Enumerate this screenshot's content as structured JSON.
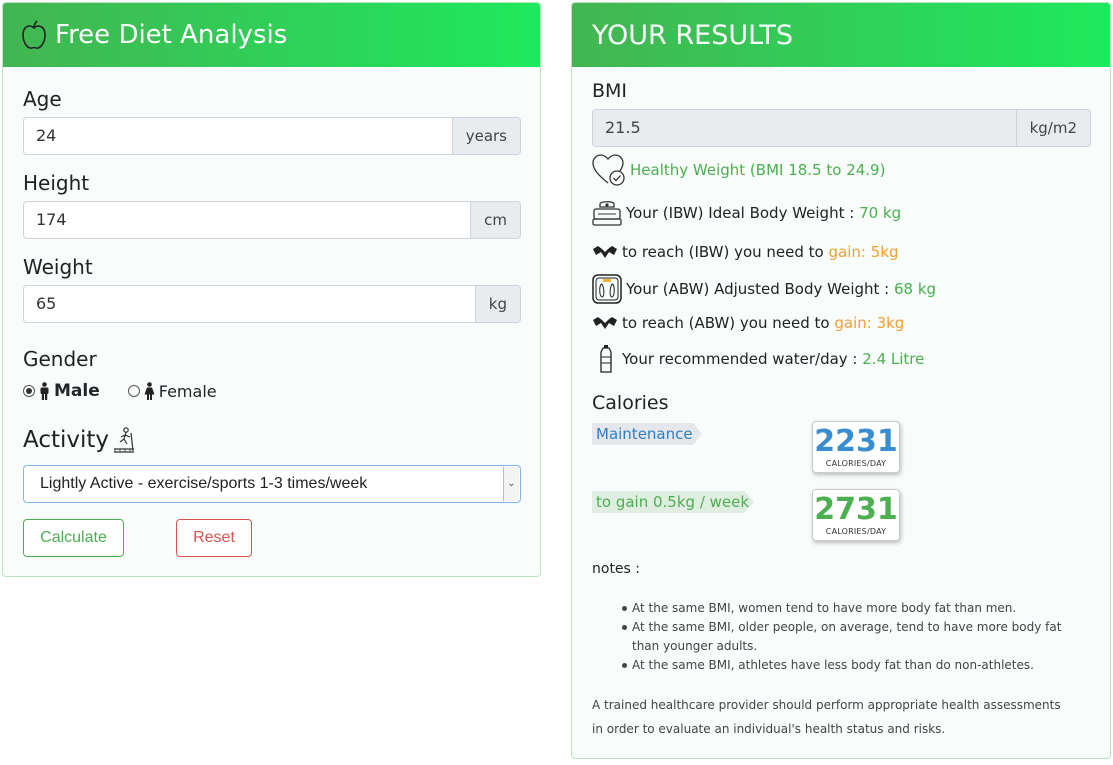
{
  "left": {
    "title": "Free Diet Analysis",
    "age": {
      "label": "Age",
      "value": "24",
      "unit": "years"
    },
    "height": {
      "label": "Height",
      "value": "174",
      "unit": "cm"
    },
    "weight": {
      "label": "Weight",
      "value": "65",
      "unit": "kg"
    },
    "gender": {
      "label": "Gender",
      "options": [
        "Male",
        "Female"
      ],
      "selected": "Male"
    },
    "activity": {
      "label": "Activity",
      "selected": "Lightly Active - exercise/sports 1-3 times/week"
    },
    "buttons": {
      "calculate": "Calculate",
      "reset": "Reset"
    }
  },
  "right": {
    "title": "YOUR RESULTS",
    "bmi": {
      "label": "BMI",
      "value": "21.5",
      "unit": "kg/m2"
    },
    "bmi_status": "Healthy Weight (BMI 18.5 to 24.9)",
    "ibw": {
      "text": "Your (IBW) Ideal Body Weight :",
      "value": "70 kg"
    },
    "ibw_reach": {
      "text": "to reach (IBW) you need to",
      "value": "gain: 5kg"
    },
    "abw": {
      "text": "Your (ABW) Adjusted Body Weight :",
      "value": "68 kg"
    },
    "abw_reach": {
      "text": "to reach (ABW) you need to",
      "value": "gain: 3kg"
    },
    "water": {
      "text": "Your recommended water/day :",
      "value": "2.4 Litre"
    },
    "calories": {
      "label": "Calories",
      "maintenance": {
        "label": "Maintenance",
        "value": "2231",
        "unit": "CALORIES/DAY"
      },
      "gain": {
        "label": "to gain 0.5kg / week",
        "value": "2731",
        "unit": "CALORIES/DAY"
      }
    },
    "notes_label": "notes :",
    "notes": [
      "At the same BMI, women tend to have more body fat than men.",
      "At the same BMI, older people, on average, tend to have more body fat than younger adults.",
      "At the same BMI, athletes have less body fat than do non-athletes."
    ],
    "footer": "A trained healthcare provider should perform appropriate health assessments in order to evaluate an individual's health status and risks."
  },
  "colors": {
    "header_start": "#43b552",
    "header_end": "#1ee95d",
    "green": "#4caf50",
    "orange": "#f0a030",
    "blue": "#3a8ed0",
    "danger": "#d9534f"
  },
  "icons": [
    "apple-icon",
    "male-icon",
    "female-icon",
    "treadmill-icon",
    "heart-check-icon",
    "scale-icon",
    "muscle-arm-icon",
    "body-scale-icon",
    "water-bottle-icon"
  ]
}
